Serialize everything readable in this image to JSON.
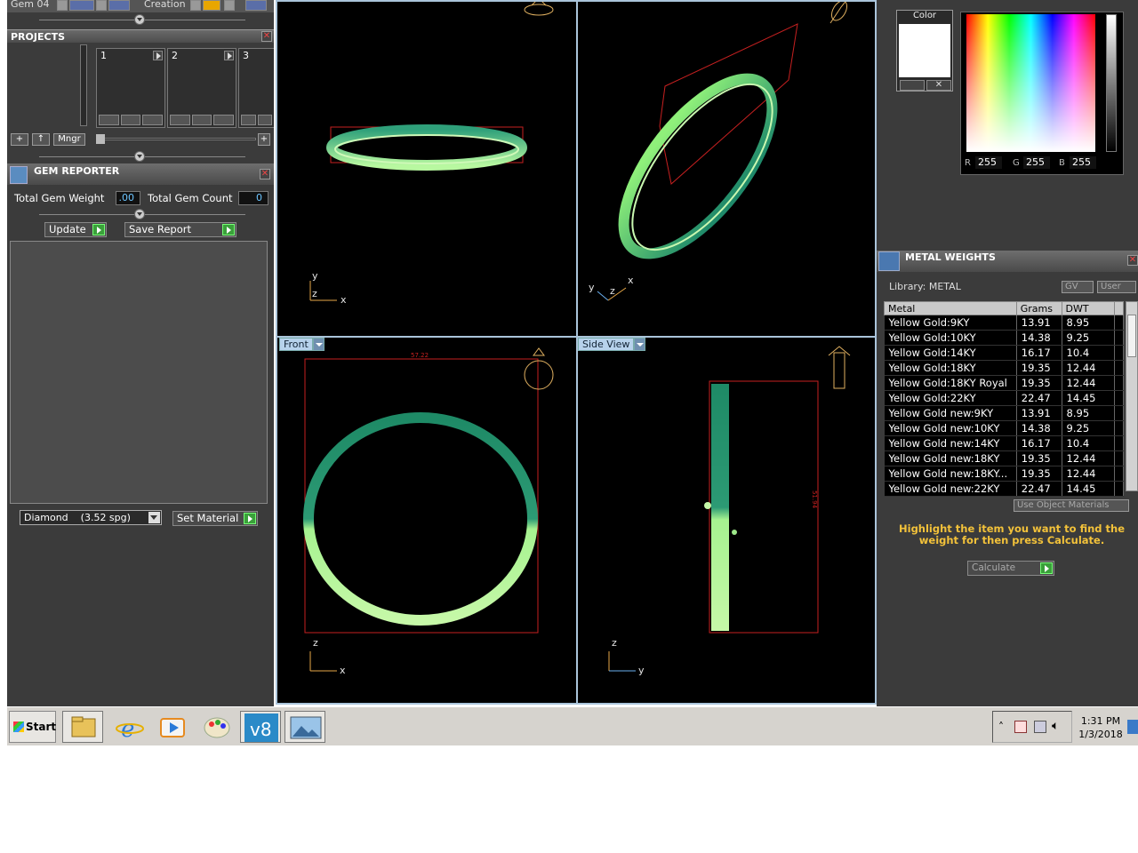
{
  "top_ribbon": {
    "gem_label": "Gem 04",
    "creation_label": "Creation"
  },
  "projects": {
    "title": "PROJECTS",
    "cards": [
      {
        "num": "1"
      },
      {
        "num": "2"
      },
      {
        "num": "3"
      }
    ],
    "mngr_label": "Mngr"
  },
  "gem_reporter": {
    "title": "GEM REPORTER",
    "total_weight_label": "Total Gem Weight",
    "total_weight_value": ".00",
    "total_count_label": "Total Gem Count",
    "total_count_value": "0",
    "update_label": "Update",
    "save_report_label": "Save Report",
    "material_selected": "Diamond    (3.52 spg)",
    "set_material_label": "Set Material"
  },
  "viewports": {
    "front_label": "Front",
    "side_label": "Side View",
    "top_left_axes": [
      "y",
      "z",
      "x"
    ],
    "top_right_axes": [
      "y",
      "z",
      "x"
    ],
    "front_axes": [
      "z",
      "x"
    ],
    "side_axes": [
      "z",
      "y"
    ],
    "front_dim": "57.22",
    "side_dim": "51.94"
  },
  "color_panel": {
    "title": "Color",
    "swatch_color": "#ffffff",
    "r_label": "R",
    "r_value": "255",
    "g_label": "G",
    "g_value": "255",
    "b_label": "B",
    "b_value": "255"
  },
  "metal_weights": {
    "title": "METAL WEIGHTS",
    "library_label": "Library: METAL",
    "gv_label": "GV",
    "user_label": "User",
    "columns": [
      "Metal",
      "Grams",
      "DWT"
    ],
    "rows": [
      [
        "Yellow Gold:9KY",
        "13.91",
        "8.95"
      ],
      [
        "Yellow Gold:10KY",
        "14.38",
        "9.25"
      ],
      [
        "Yellow Gold:14KY",
        "16.17",
        "10.4"
      ],
      [
        "Yellow Gold:18KY",
        "19.35",
        "12.44"
      ],
      [
        "Yellow Gold:18KY Royal",
        "19.35",
        "12.44"
      ],
      [
        "Yellow Gold:22KY",
        "22.47",
        "14.45"
      ],
      [
        "Yellow Gold new:9KY",
        "13.91",
        "8.95"
      ],
      [
        "Yellow Gold new:10KY",
        "14.38",
        "9.25"
      ],
      [
        "Yellow Gold new:14KY",
        "16.17",
        "10.4"
      ],
      [
        "Yellow Gold new:18KY",
        "19.35",
        "12.44"
      ],
      [
        "Yellow Gold new:18KY...",
        "19.35",
        "12.44"
      ],
      [
        "Yellow Gold new:22KY",
        "22.47",
        "14.45"
      ]
    ],
    "use_object_materials_label": "Use Object Materials",
    "hint": "Highlight the item you want to find the weight for then press Calculate.",
    "calculate_label": "Calculate"
  },
  "taskbar": {
    "start_label": "Start",
    "apps": [
      "file-explorer-icon",
      "internet-explorer-icon",
      "media-player-icon",
      "paint-icon",
      "matrix-v8-icon",
      "photo-viewer-icon"
    ],
    "time": "1:31 PM",
    "date": "1/3/2018"
  }
}
